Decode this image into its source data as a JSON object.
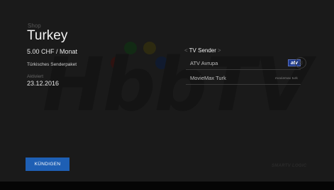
{
  "screen": {
    "breadcrumb": "Shop",
    "title": "Turkey",
    "price": "5.00 CHF / Monat",
    "description": "Türkisches Senderpaket",
    "activated_label": "Aktiviert",
    "activated_date": "23.12.2016"
  },
  "senders": {
    "heading": "TV Sender",
    "items": [
      {
        "name": "ATV Avrupa",
        "logo_text": "atv",
        "icon": "atv-logo-icon"
      },
      {
        "name": "MovieMax Turk",
        "logo_text": "moviemax turk",
        "icon": "moviemax-logo-icon"
      }
    ]
  },
  "actions": {
    "cancel_label": "KÜNDIGEN"
  },
  "watermark": {
    "text": "HbbTV",
    "brand": "SMARTV LOGIC"
  },
  "colors": {
    "accent": "#1e5fb4",
    "background": "#1a1a1a"
  }
}
